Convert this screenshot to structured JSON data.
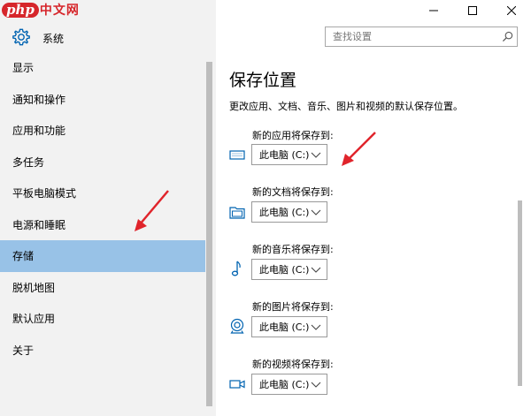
{
  "watermark": {
    "php": "php",
    "cn": "中文网"
  },
  "window": {
    "title": "系统"
  },
  "search": {
    "placeholder": "查找设置"
  },
  "sidebar": {
    "items": [
      {
        "label": "显示"
      },
      {
        "label": "通知和操作"
      },
      {
        "label": "应用和功能"
      },
      {
        "label": "多任务"
      },
      {
        "label": "平板电脑模式"
      },
      {
        "label": "电源和睡眠"
      },
      {
        "label": "存储",
        "active": true
      },
      {
        "label": "脱机地图"
      },
      {
        "label": "默认应用"
      },
      {
        "label": "关于"
      }
    ]
  },
  "main": {
    "title": "保存位置",
    "description": "更改应用、文档、音乐、图片和视频的默认保存位置。",
    "locations": [
      {
        "label": "新的应用将保存到:",
        "value": "此电脑 (C:)",
        "icon": "monitor-icon"
      },
      {
        "label": "新的文档将保存到:",
        "value": "此电脑 (C:)",
        "icon": "folder-icon"
      },
      {
        "label": "新的音乐将保存到:",
        "value": "此电脑 (C:)",
        "icon": "music-note-icon"
      },
      {
        "label": "新的图片将保存到:",
        "value": "此电脑 (C:)",
        "icon": "camera-icon"
      },
      {
        "label": "新的视频将保存到:",
        "value": "此电脑 (C:)",
        "icon": "video-camera-icon"
      }
    ]
  },
  "colors": {
    "accent": "#0063b1",
    "active_nav": "#98c2e7",
    "arrow": "#e0242b",
    "pane_bg": "#f2f2f2"
  }
}
